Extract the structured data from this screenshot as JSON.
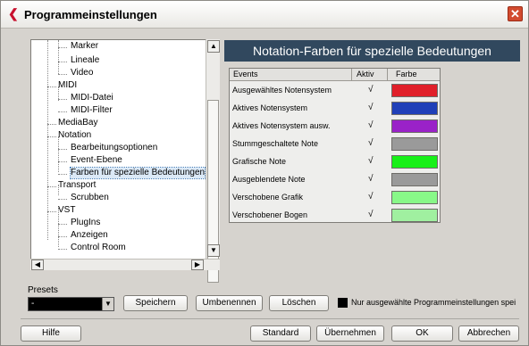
{
  "window": {
    "title": "Programmeinstellungen",
    "close_glyph": "✕",
    "app_icon": "cubase-icon",
    "app_glyph": "❮"
  },
  "tree": {
    "items": [
      {
        "label": "Marker",
        "level": 2
      },
      {
        "label": "Lineale",
        "level": 2
      },
      {
        "label": "Video",
        "level": 2
      },
      {
        "label": "MIDI",
        "level": 1
      },
      {
        "label": "MIDI-Datei",
        "level": 2
      },
      {
        "label": "MIDI-Filter",
        "level": 2
      },
      {
        "label": "MediaBay",
        "level": 1
      },
      {
        "label": "Notation",
        "level": 1
      },
      {
        "label": "Bearbeitungsoptionen",
        "level": 2
      },
      {
        "label": "Event-Ebene",
        "level": 2
      },
      {
        "label": "Farben für spezielle Bedeutungen",
        "level": 2,
        "selected": true
      },
      {
        "label": "Transport",
        "level": 1
      },
      {
        "label": "Scrubben",
        "level": 2
      },
      {
        "label": "VST",
        "level": 1
      },
      {
        "label": "PlugIns",
        "level": 2
      },
      {
        "label": "Anzeigen",
        "level": 2
      },
      {
        "label": "Control Room",
        "level": 2
      }
    ]
  },
  "panel": {
    "header": "Notation-Farben für spezielle Bedeutungen"
  },
  "table": {
    "columns": [
      "Events",
      "Aktiv",
      "Farbe"
    ],
    "rows": [
      {
        "event": "Ausgewähltes Notensystem",
        "active": "√",
        "color": "#e0202a"
      },
      {
        "event": "Aktives Notensystem",
        "active": "√",
        "color": "#2040b8"
      },
      {
        "event": "Aktives Notensystem ausw.",
        "active": "√",
        "color": "#9a22c8"
      },
      {
        "event": "Stummgeschaltete Note",
        "active": "√",
        "color": "#9a9a9a"
      },
      {
        "event": "Grafische Note",
        "active": "√",
        "color": "#18f018"
      },
      {
        "event": "Ausgeblendete Note",
        "active": "√",
        "color": "#9a9a9a"
      },
      {
        "event": "Verschobene Grafik",
        "active": "√",
        "color": "#88f888"
      },
      {
        "event": "Verschobener Bogen",
        "active": "√",
        "color": "#a0f0a0"
      }
    ]
  },
  "presets": {
    "label": "Presets",
    "value": "-",
    "save": "Speichern",
    "rename": "Umbenennen",
    "delete": "Löschen",
    "checkbox_label": "Nur ausgewählte Programmeinstellungen spei"
  },
  "footer": {
    "help": "Hilfe",
    "standard": "Standard",
    "apply": "Übernehmen",
    "ok": "OK",
    "cancel": "Abbrechen"
  }
}
